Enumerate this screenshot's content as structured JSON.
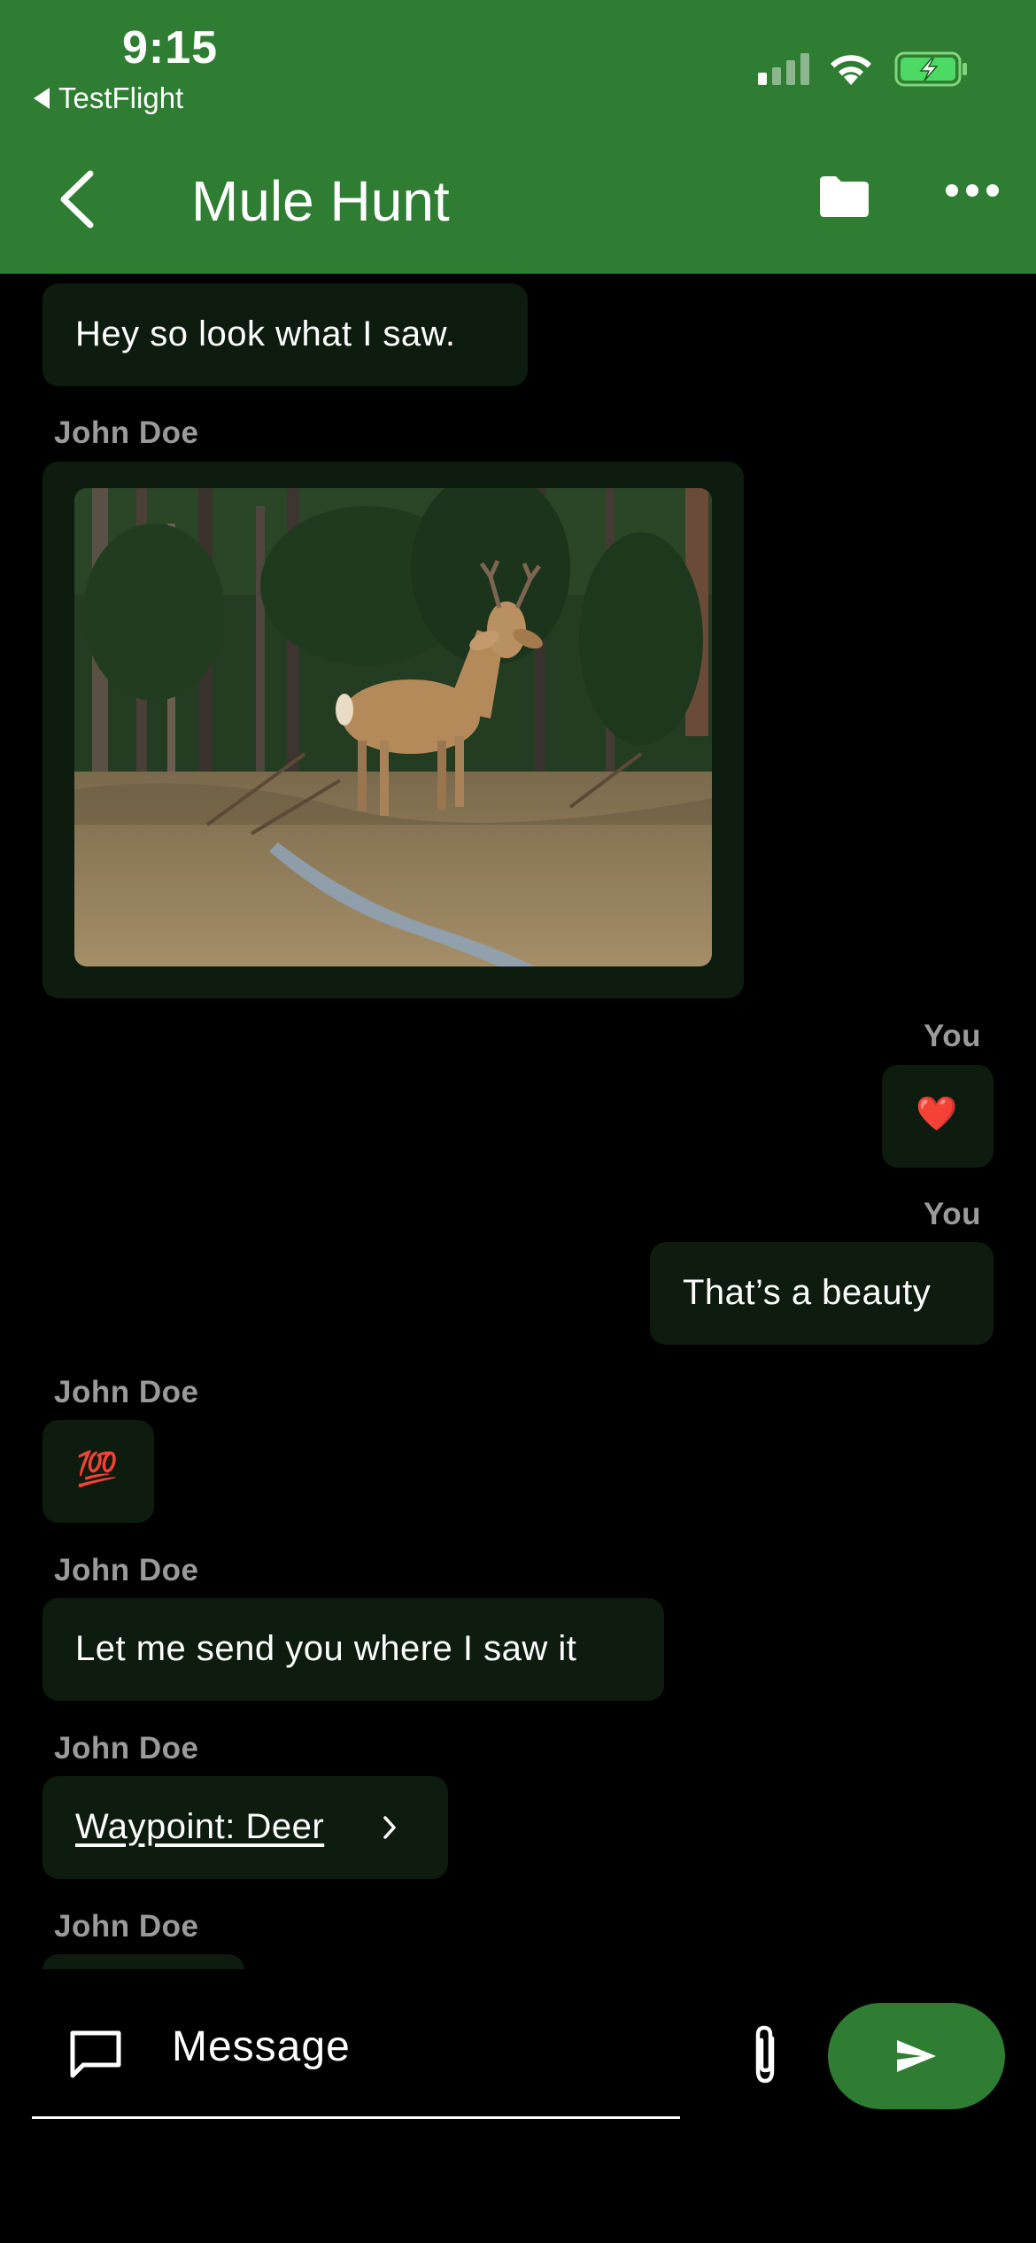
{
  "status_bar": {
    "time": "9:15",
    "back_app": "TestFlight",
    "signal_icon": "cellular-signal-icon",
    "wifi_icon": "wifi-icon",
    "battery_icon": "battery-charging-icon"
  },
  "header": {
    "title": "Mule Hunt",
    "back_icon": "chevron-left-icon",
    "folder_icon": "folder-icon",
    "more_icon": "more-horizontal-icon",
    "background": "#2e7d32"
  },
  "messages": [
    {
      "sender": "",
      "type": "text",
      "text": "Hey so look what I saw."
    },
    {
      "sender": "John Doe",
      "type": "image",
      "image_icon": "deer-photo"
    },
    {
      "sender": "You",
      "type": "emoji",
      "text": "❤️"
    },
    {
      "sender": "You",
      "type": "text",
      "text": "That’s a beauty"
    },
    {
      "sender": "John Doe",
      "type": "emoji",
      "text": "💯"
    },
    {
      "sender": "John Doe",
      "type": "text",
      "text": "Let me send you where I saw it"
    },
    {
      "sender": "John Doe",
      "type": "link",
      "text": "Waypoint: Deer",
      "icon": "chevron-right-icon"
    },
    {
      "sender": "John Doe",
      "type": "partial",
      "text": ""
    }
  ],
  "composer": {
    "placeholder": "Message",
    "message_icon": "chat-bubble-icon",
    "attach_icon": "paperclip-icon",
    "send_icon": "send-icon",
    "accent": "#2e7d32"
  },
  "colors": {
    "bubble": "#0d1c0f",
    "sender_label": "#9a9a9a",
    "background": "#000000"
  }
}
